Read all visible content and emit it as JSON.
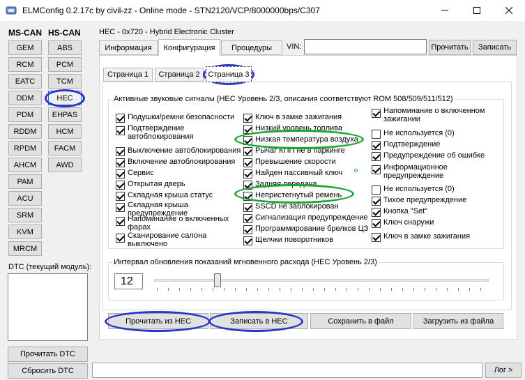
{
  "window": {
    "title": "ELMConfig 0.2.17c by civil-zz - Online mode - STN2120/VCP/8000000bps/C307"
  },
  "sidebar": {
    "ms_can_label": "MS-CAN",
    "hs_can_label": "HS-CAN",
    "ms_can_modules": [
      "GEM",
      "RCM",
      "EATC",
      "DDM",
      "PDM",
      "RDDM",
      "RPDM",
      "AHCM",
      "PAM",
      "ACU",
      "SRM",
      "KVM",
      "MRCM"
    ],
    "hs_can_modules": [
      "ABS",
      "PCM",
      "TCM",
      "HEC",
      "EHPAS",
      "HCM",
      "FACM",
      "AWD"
    ],
    "selected_module": "HEC",
    "dtc_label": "DTC (текущий модуль):",
    "read_dtc": "Прочитать DTC",
    "clear_dtc": "Сбросить DTC"
  },
  "module_header": "HEC - 0x720 - Hybrid Electronic Cluster",
  "main_tabs": [
    "Информация",
    "Конфигурация",
    "Процедуры"
  ],
  "active_main_tab": "Конфигурация",
  "vin": {
    "label": "VIN:",
    "value": "",
    "read": "Прочитать",
    "write": "Записать"
  },
  "page_tabs": [
    "Страница 1",
    "Страница 2",
    "Страница 3"
  ],
  "active_page_tab": "Страница 3",
  "sound_group": {
    "title": "Активные звуковые сигналы (HEC Уровень 2/3, описания соответствуют ROM 508/509/511/512)",
    "col1": [
      {
        "label": "Подушки/ремни безопасности",
        "checked": true
      },
      {
        "label": "Подтверждение автоблокирования",
        "checked": true
      },
      {
        "label": "Выключение автоблокирования",
        "checked": true
      },
      {
        "label": "Включение автоблокирования",
        "checked": true
      },
      {
        "label": "Сервис",
        "checked": true
      },
      {
        "label": "Открытая дверь",
        "checked": true
      },
      {
        "label": "Складная крыша статус",
        "checked": true
      },
      {
        "label": "Складная крыша предупреждение",
        "checked": true
      },
      {
        "label": "Напоминание о включенных фарах",
        "checked": true
      },
      {
        "label": "Сканирование салона выключено",
        "checked": true
      }
    ],
    "col2": [
      {
        "label": "Ключ в замке зажигания",
        "checked": true
      },
      {
        "label": "Низкий уровень топлива",
        "checked": true
      },
      {
        "label": "Низкая температура воздуха",
        "checked": true
      },
      {
        "label": "Рычаг КПП не в паркинге",
        "checked": true
      },
      {
        "label": "Превышение скорости",
        "checked": true
      },
      {
        "label": "Найден пассивный ключ",
        "checked": true
      },
      {
        "label": "Задняя передача",
        "checked": true
      },
      {
        "label": "Непристегнутый ремень",
        "checked": true
      },
      {
        "label": "SSCD не заблокирован",
        "checked": true
      },
      {
        "label": "Сигнализация предупреждение",
        "checked": true
      },
      {
        "label": "Программирование брелков ЦЗ",
        "checked": true
      },
      {
        "label": "Щелчки поворотников",
        "checked": true
      }
    ],
    "col3": [
      {
        "label": "Напоминание о включенном зажигании",
        "checked": true
      },
      {
        "label": "Не используется (0)",
        "checked": false
      },
      {
        "label": "Подтверждение",
        "checked": true
      },
      {
        "label": "Предупреждение об ошибке",
        "checked": true
      },
      {
        "label": "Информационное предупреждение",
        "checked": true
      },
      {
        "label": "Не используется (0)",
        "checked": false
      },
      {
        "label": "Тихое предупреждение",
        "checked": true
      },
      {
        "label": "Кнопка \"Set\"",
        "checked": true
      },
      {
        "label": "Ключ снаружи",
        "checked": true
      },
      {
        "label": "Ключ в замке зажигания",
        "checked": true
      }
    ]
  },
  "interval_group": {
    "title": "Интервал обновления показаний мгновенного расхода (HEC Уровень 2/3)",
    "value": "12",
    "slider_fraction": 0.19
  },
  "actions": {
    "read_hec": "Прочитать из HEC",
    "write_hec": "Записать в HEC",
    "save_file": "Сохранить в файл",
    "load_file": "Загрузить из файла"
  },
  "status": {
    "log_button": "Лог >"
  },
  "colors": {
    "highlight_blue": "#2c35c8",
    "highlight_green": "#17a834"
  }
}
